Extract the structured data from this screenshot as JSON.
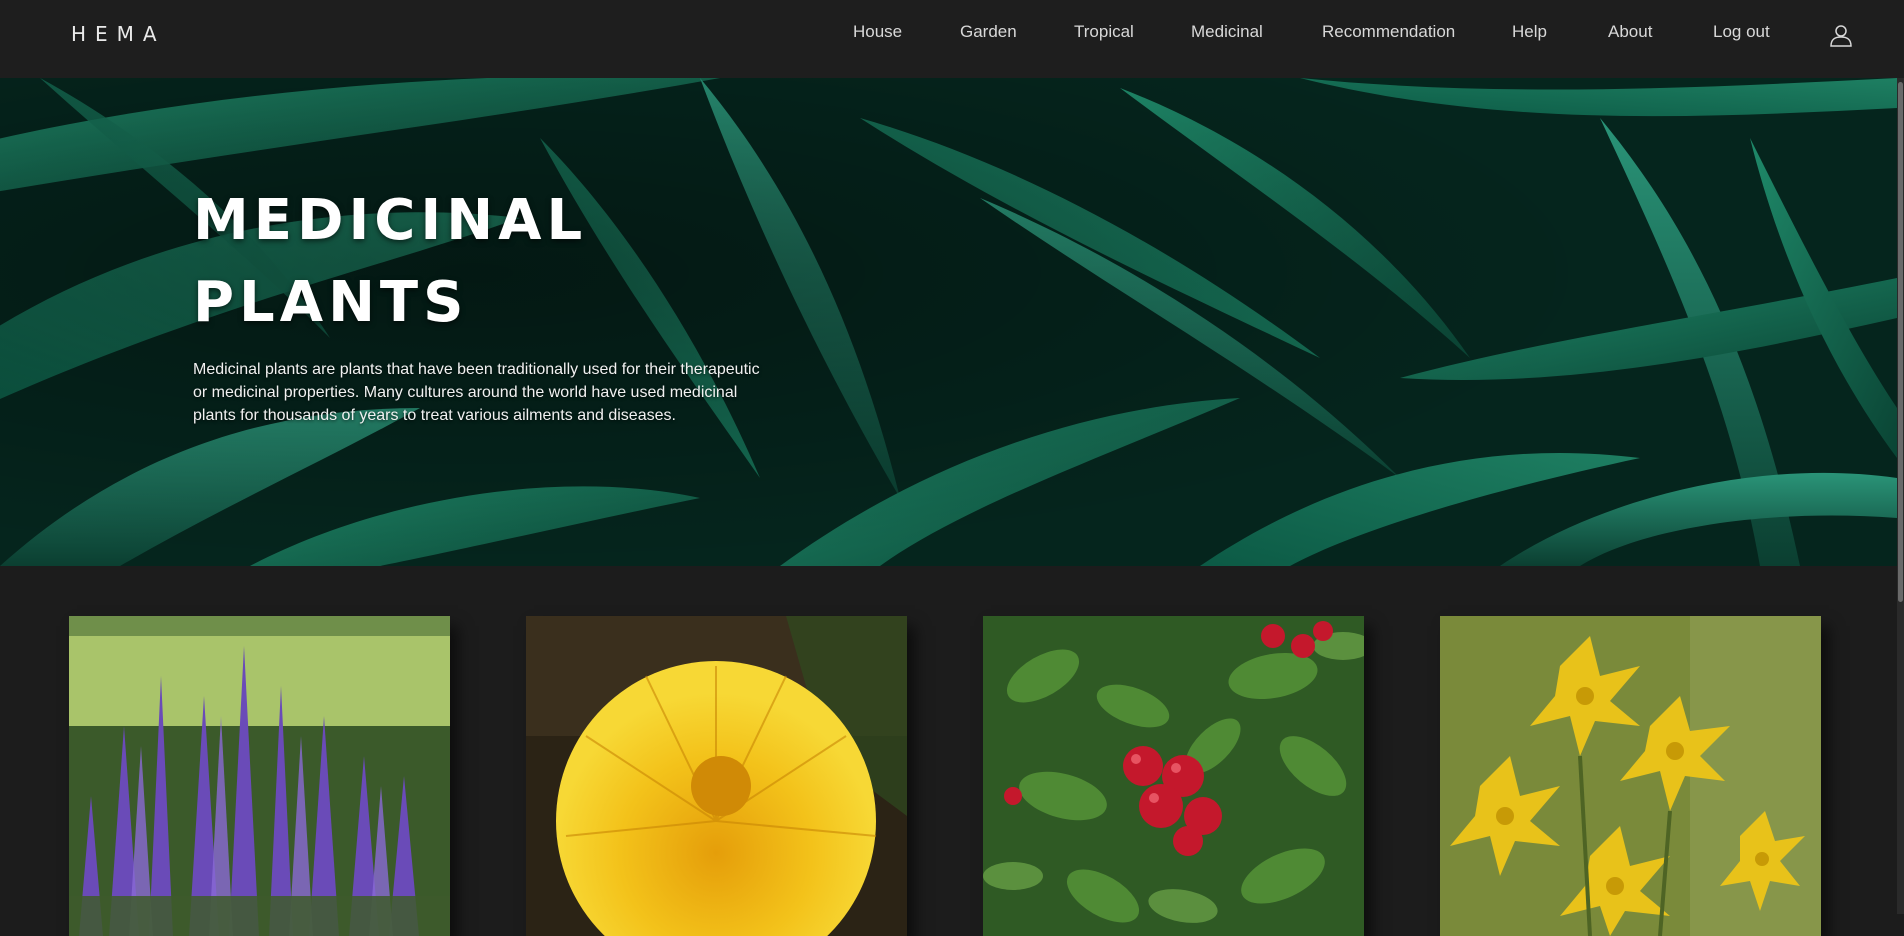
{
  "brand": "HEMA",
  "nav": {
    "items": [
      {
        "label": "House"
      },
      {
        "label": "Garden"
      },
      {
        "label": "Tropical"
      },
      {
        "label": "Medicinal"
      },
      {
        "label": "Recommendation"
      },
      {
        "label": "Help"
      },
      {
        "label": "About"
      },
      {
        "label": "Log out"
      }
    ],
    "user_icon": "user-icon"
  },
  "hero": {
    "title_line1": "MEDICINAL",
    "title_line2": "PLANTS",
    "description": "Medicinal plants are plants that have been traditionally used for their therapeutic or medicinal properties. Many cultures around the world have used medicinal plants for thousands of years to treat various ailments and diseases."
  },
  "cards": [
    {
      "image": "lavender-sage-flower"
    },
    {
      "image": "yellow-dandelion-flower"
    },
    {
      "image": "red-lingonberry-shrub"
    },
    {
      "image": "yellow-st-johns-wort-flower"
    }
  ],
  "colors": {
    "navbar_bg": "#1e1e1e",
    "page_bg": "#1c1c1c",
    "hero_green": "#0d5a45",
    "nav_text": "#d8d8d8"
  }
}
